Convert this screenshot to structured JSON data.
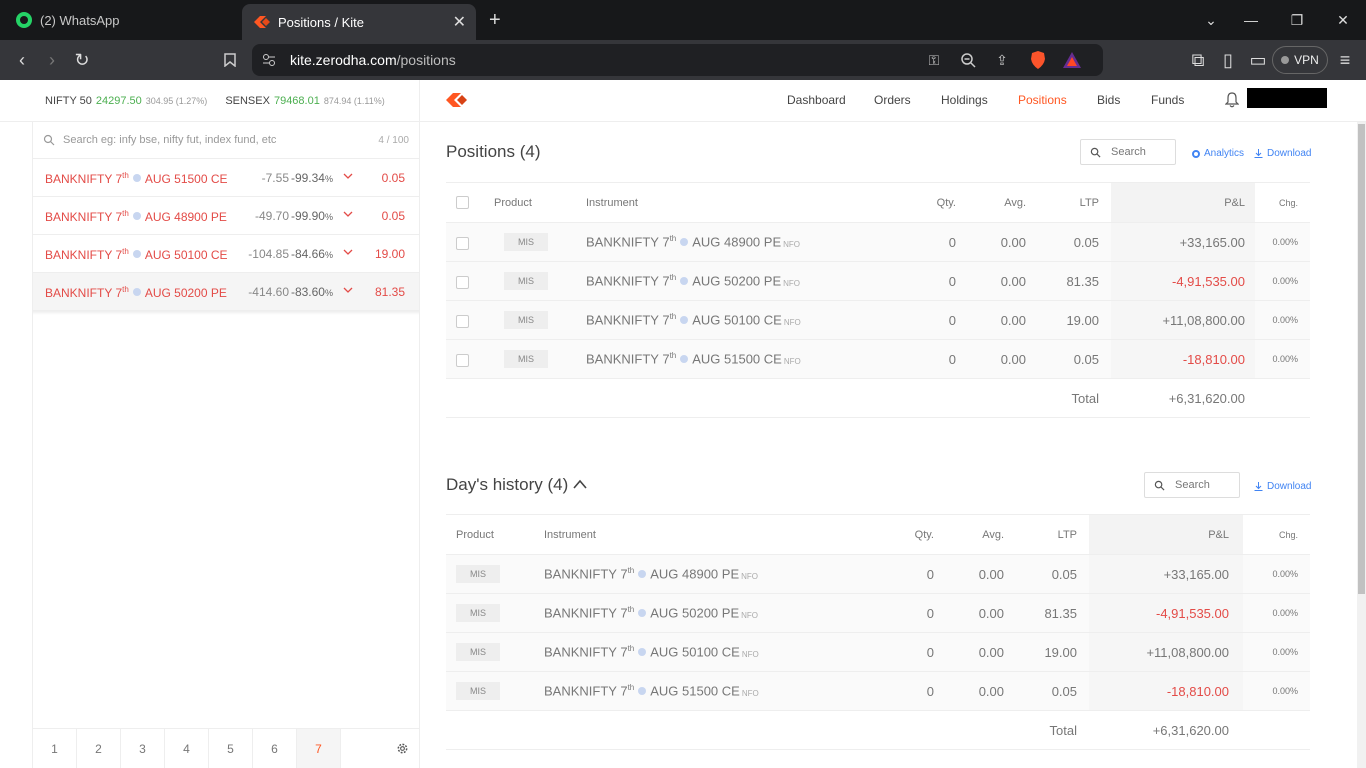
{
  "browser": {
    "tabs": [
      {
        "title": "(2) WhatsApp"
      },
      {
        "title": "Positions / Kite"
      }
    ],
    "url_host": "kite.zerodha.com",
    "url_path": "/positions",
    "vpn_label": "VPN"
  },
  "indices": [
    {
      "name": "NIFTY 50",
      "value": "24297.50",
      "change": "304.95 (1.27%)"
    },
    {
      "name": "SENSEX",
      "value": "79468.01",
      "change": "874.94 (1.11%)"
    }
  ],
  "nav": {
    "links": [
      "Dashboard",
      "Orders",
      "Holdings",
      "Positions",
      "Bids",
      "Funds"
    ],
    "active": "Positions"
  },
  "marketwatch": {
    "search_placeholder": "Search eg: infy bse, nifty fut, index fund, etc",
    "count": "4 / 100",
    "items": [
      {
        "sym": "BANKNIFTY 7",
        "sup": "th",
        "rest": "AUG 51500 CE",
        "change": "-7.55",
        "pct": "-99.34",
        "pct_unit": "%",
        "ltp": "0.05"
      },
      {
        "sym": "BANKNIFTY 7",
        "sup": "th",
        "rest": "AUG 48900 PE",
        "change": "-49.70",
        "pct": "-99.90",
        "pct_unit": "%",
        "ltp": "0.05"
      },
      {
        "sym": "BANKNIFTY 7",
        "sup": "th",
        "rest": "AUG 50100 CE",
        "change": "-104.85",
        "pct": "-84.66",
        "pct_unit": "%",
        "ltp": "19.00"
      },
      {
        "sym": "BANKNIFTY 7",
        "sup": "th",
        "rest": "AUG 50200 PE",
        "change": "-414.60",
        "pct": "-83.60",
        "pct_unit": "%",
        "ltp": "81.35"
      }
    ],
    "pages": [
      "1",
      "2",
      "3",
      "4",
      "5",
      "6",
      "7"
    ],
    "active_page": "7"
  },
  "positions": {
    "title": "Positions (4)",
    "search_placeholder": "Search",
    "analytics_label": "Analytics",
    "download_label": "Download",
    "headers": {
      "product": "Product",
      "instrument": "Instrument",
      "qty": "Qty.",
      "avg": "Avg.",
      "ltp": "LTP",
      "pnl": "P&L",
      "chg": "Chg."
    },
    "rows": [
      {
        "product": "MIS",
        "sym": "BANKNIFTY 7",
        "sup": "th",
        "rest": "AUG 48900 PE",
        "exch": "NFO",
        "qty": "0",
        "avg": "0.00",
        "ltp": "0.05",
        "pnl": "+33,165.00",
        "chg": "0.00%"
      },
      {
        "product": "MIS",
        "sym": "BANKNIFTY 7",
        "sup": "th",
        "rest": "AUG 50200 PE",
        "exch": "NFO",
        "qty": "0",
        "avg": "0.00",
        "ltp": "81.35",
        "pnl": "-4,91,535.00",
        "chg": "0.00%"
      },
      {
        "product": "MIS",
        "sym": "BANKNIFTY 7",
        "sup": "th",
        "rest": "AUG 50100 CE",
        "exch": "NFO",
        "qty": "0",
        "avg": "0.00",
        "ltp": "19.00",
        "pnl": "+11,08,800.00",
        "chg": "0.00%"
      },
      {
        "product": "MIS",
        "sym": "BANKNIFTY 7",
        "sup": "th",
        "rest": "AUG 51500 CE",
        "exch": "NFO",
        "qty": "0",
        "avg": "0.00",
        "ltp": "0.05",
        "pnl": "-18,810.00",
        "chg": "0.00%"
      }
    ],
    "total_label": "Total",
    "total_value": "+6,31,620.00"
  },
  "history": {
    "title": "Day's history (4)",
    "search_placeholder": "Search",
    "download_label": "Download",
    "headers": {
      "product": "Product",
      "instrument": "Instrument",
      "qty": "Qty.",
      "avg": "Avg.",
      "ltp": "LTP",
      "pnl": "P&L",
      "chg": "Chg."
    },
    "rows": [
      {
        "product": "MIS",
        "sym": "BANKNIFTY 7",
        "sup": "th",
        "rest": "AUG 48900 PE",
        "exch": "NFO",
        "qty": "0",
        "avg": "0.00",
        "ltp": "0.05",
        "pnl": "+33,165.00",
        "chg": "0.00%"
      },
      {
        "product": "MIS",
        "sym": "BANKNIFTY 7",
        "sup": "th",
        "rest": "AUG 50200 PE",
        "exch": "NFO",
        "qty": "0",
        "avg": "0.00",
        "ltp": "81.35",
        "pnl": "-4,91,535.00",
        "chg": "0.00%"
      },
      {
        "product": "MIS",
        "sym": "BANKNIFTY 7",
        "sup": "th",
        "rest": "AUG 50100 CE",
        "exch": "NFO",
        "qty": "0",
        "avg": "0.00",
        "ltp": "19.00",
        "pnl": "+11,08,800.00",
        "chg": "0.00%"
      },
      {
        "product": "MIS",
        "sym": "BANKNIFTY 7",
        "sup": "th",
        "rest": "AUG 51500 CE",
        "exch": "NFO",
        "qty": "0",
        "avg": "0.00",
        "ltp": "0.05",
        "pnl": "-18,810.00",
        "chg": "0.00%"
      }
    ],
    "total_label": "Total",
    "total_value": "+6,31,620.00"
  },
  "colors": {
    "accent": "#ff5722",
    "loss": "#e34b47",
    "gain": "#4caf50",
    "link": "#4184f3"
  }
}
